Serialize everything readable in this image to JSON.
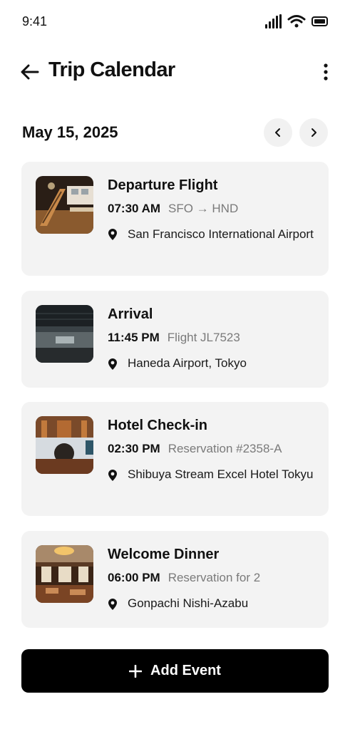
{
  "status_bar": {
    "time": "9:41"
  },
  "header": {
    "title": "Trip Calendar"
  },
  "date_nav": {
    "date": "May 15, 2025"
  },
  "events": [
    {
      "title": "Departure Flight",
      "time": "07:30 AM",
      "subtitle": "SFO → HND",
      "location": "San Francisco International Airport",
      "image": "airport-departure-photo"
    },
    {
      "title": "Arrival",
      "time": "11:45 PM",
      "subtitle": "Flight JL7523",
      "location": "Haneda Airport, Tokyo",
      "image": "airport-arrival-photo"
    },
    {
      "title": "Hotel Check-in",
      "time": "02:30 PM",
      "subtitle": "Reservation #2358-A",
      "location": "Shibuya Stream Excel Hotel Tokyu",
      "image": "hotel-lobby-photo"
    },
    {
      "title": "Welcome Dinner",
      "time": "06:00 PM",
      "subtitle": "Reservation for 2",
      "location": "Gonpachi Nishi-Azabu",
      "image": "restaurant-interior-photo"
    }
  ],
  "actions": {
    "add_event": "Add Event"
  }
}
